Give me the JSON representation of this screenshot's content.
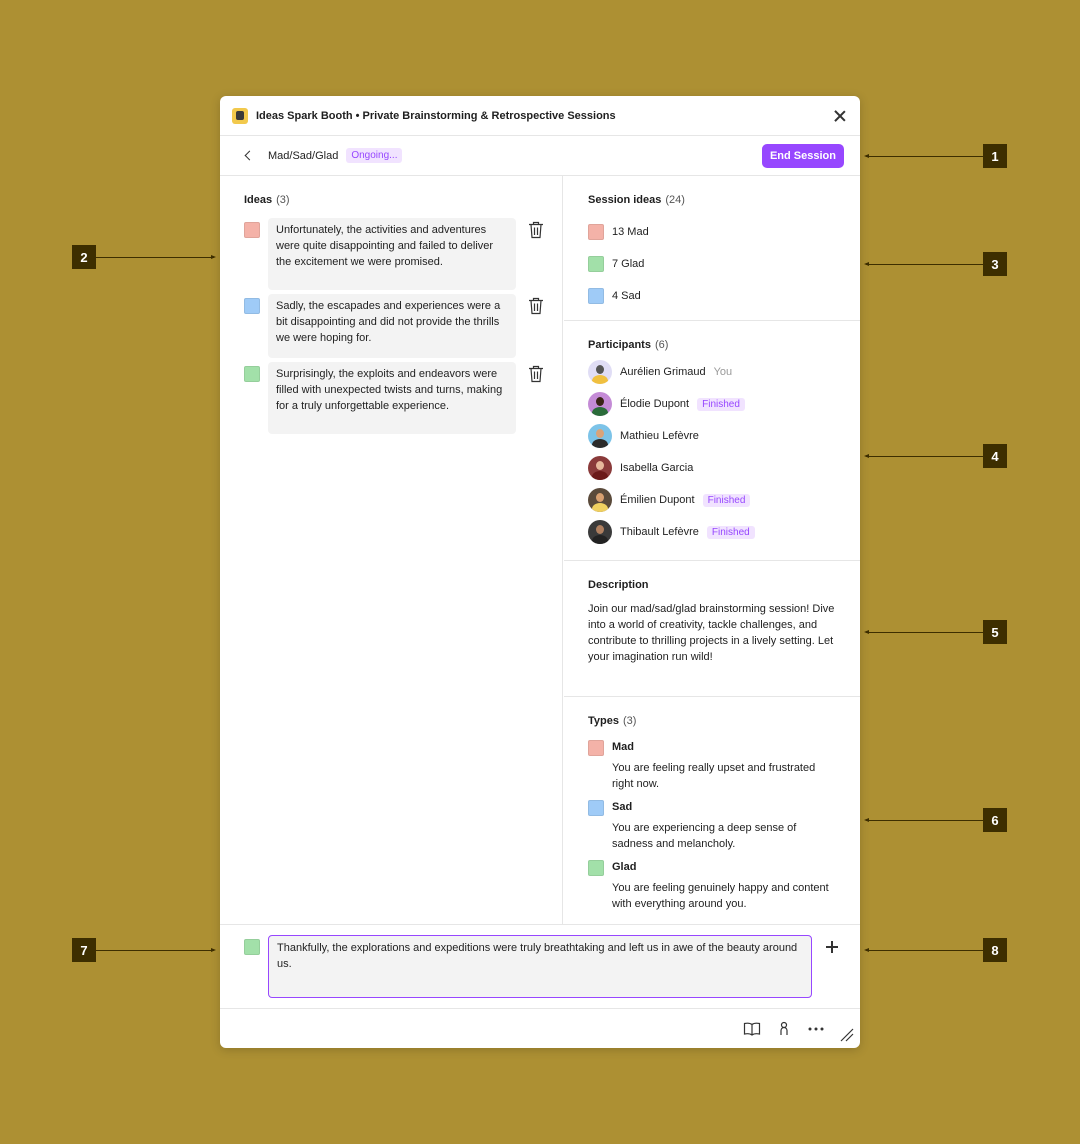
{
  "window": {
    "title": "Ideas Spark Booth • Private Brainstorming & Retrospective Sessions"
  },
  "toolbar": {
    "breadcrumb": "Mad/Sad/Glad",
    "status": "Ongoing...",
    "end_label": "End Session"
  },
  "ideas": {
    "heading": "Ideas",
    "count": "(3)",
    "items": [
      {
        "type": "Mad",
        "color": "#f4b2a8",
        "text": "Unfortunately, the activities and adventures were quite disappointing and failed to deliver the excitement we were promised."
      },
      {
        "type": "Sad",
        "color": "#9fcbf7",
        "text": "Sadly, the escapades and experiences were a bit disappointing and did not provide the thrills we were hoping for."
      },
      {
        "type": "Glad",
        "color": "#a2e0a9",
        "text": "Surprisingly, the exploits and endeavors were filled with unexpected twists and turns, making for a truly unforgettable experience."
      }
    ]
  },
  "session_ideas": {
    "heading": "Session ideas",
    "count": "(24)",
    "items": [
      {
        "label": "13 Mad",
        "color": "#f4b2a8"
      },
      {
        "label": "7 Glad",
        "color": "#a2e0a9"
      },
      {
        "label": "4 Sad",
        "color": "#9fcbf7"
      }
    ]
  },
  "participants": {
    "heading": "Participants",
    "count": "(6)",
    "you_label": "You",
    "finished_label": "Finished",
    "items": [
      {
        "name": "Aurélien Grimaud",
        "you": true,
        "finished": false
      },
      {
        "name": "Élodie Dupont",
        "you": false,
        "finished": true
      },
      {
        "name": "Mathieu Lefèvre",
        "you": false,
        "finished": false
      },
      {
        "name": "Isabella Garcia",
        "you": false,
        "finished": false
      },
      {
        "name": "Émilien Dupont",
        "you": false,
        "finished": true
      },
      {
        "name": "Thibault Lefèvre",
        "you": false,
        "finished": true
      }
    ]
  },
  "description": {
    "heading": "Description",
    "text": "Join our mad/sad/glad brainstorming session! Dive into a world of creativity, tackle challenges, and contribute to thrilling projects in a lively setting. Let your imagination run wild!"
  },
  "types": {
    "heading": "Types",
    "count": "(3)",
    "items": [
      {
        "name": "Mad",
        "color": "#f4b2a8",
        "desc": "You are feeling really upset and frustrated right now."
      },
      {
        "name": "Sad",
        "color": "#9fcbf7",
        "desc": "You are experiencing a deep sense of sadness and melancholy."
      },
      {
        "name": "Glad",
        "color": "#a2e0a9",
        "desc": "You are feeling genuinely happy and content with everything around you."
      }
    ]
  },
  "composer": {
    "type_color": "#a2e0a9",
    "value": "Thankfully, the explorations and expeditions were truly breathtaking and left us in awe of the beauty around us."
  },
  "footer": {
    "icons": [
      "book-icon",
      "person-icon",
      "more-icon",
      "resize-grip-icon"
    ]
  },
  "annotations": [
    "1",
    "2",
    "3",
    "4",
    "5",
    "6",
    "7",
    "8"
  ],
  "colors": {
    "background": "#ad9033",
    "accent": "#9747ff",
    "badge_bg": "#f1e3ff",
    "annotation": "#3d2e00"
  }
}
